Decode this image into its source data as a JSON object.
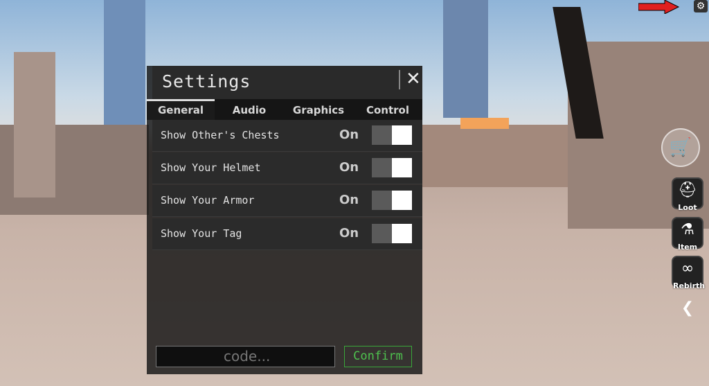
{
  "settings": {
    "title": "Settings",
    "tabs": [
      "General",
      "Audio",
      "Graphics",
      "Control"
    ],
    "active_tab": "General",
    "rows": [
      {
        "label": "Show Other's Chests",
        "state": "On"
      },
      {
        "label": "Show Your Helmet",
        "state": "On"
      },
      {
        "label": "Show Your Armor",
        "state": "On"
      },
      {
        "label": "Show Your Tag",
        "state": "On"
      }
    ],
    "code_placeholder": "code...",
    "confirm_label": "Confirm"
  },
  "side_buttons": [
    {
      "label": "Loot",
      "icon": "helmet-icon"
    },
    {
      "label": "Item",
      "icon": "potion-icon"
    },
    {
      "label": "Rebirth",
      "icon": "infinity-icon"
    }
  ],
  "colors": {
    "confirm": "#4ec24e",
    "arrow": "#e02020"
  }
}
